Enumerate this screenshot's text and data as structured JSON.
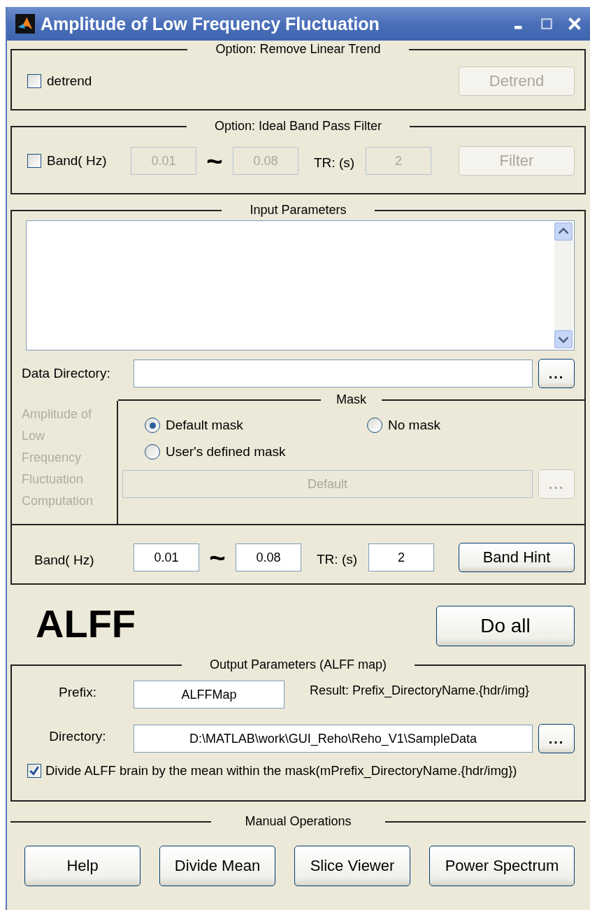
{
  "window": {
    "title": "Amplitude of Low Frequency Fluctuation"
  },
  "detrend_panel": {
    "title": "Option: Remove Linear Trend",
    "checkbox": {
      "label": "detrend",
      "checked": false
    },
    "button": {
      "label": "Detrend",
      "disabled": true
    }
  },
  "filter_panel": {
    "title": "Option: Ideal Band Pass Filter",
    "checkbox": {
      "label": "Band( Hz)",
      "checked": false
    },
    "fields_disabled": true,
    "low": "0.01",
    "tilde": "~",
    "high": "0.08",
    "tr_label": "TR: (s)",
    "tr": "2",
    "button": {
      "label": "Filter",
      "disabled": true
    }
  },
  "input_panel": {
    "title": "Input Parameters",
    "data_directory_label": "Data Directory:",
    "browse_button": {
      "label": "...",
      "disabled": false
    },
    "side_text": "Amplitude of Low Frequency Fluctuation Computation",
    "mask": {
      "title": "Mask",
      "options": [
        {
          "label": "Default mask",
          "selected": true
        },
        {
          "label": "No mask",
          "selected": false
        },
        {
          "label": "User's defined mask",
          "selected": false
        }
      ],
      "mask_field": {
        "value": "Default",
        "disabled": true
      },
      "browse_button": {
        "label": "...",
        "disabled": true
      }
    },
    "band_label": "Band( Hz)",
    "low": "0.01",
    "tilde": "~",
    "high": "0.08",
    "tr_label": "TR: (s)",
    "tr": "2",
    "hint_button": "Band Hint"
  },
  "heading": "ALFF",
  "do_all_button": "Do all",
  "output_panel": {
    "title": "Output Parameters (ALFF map)",
    "prefix_label": "Prefix:",
    "prefix": "ALFFMap",
    "result_note": "Result: Prefix_DirectoryName.{hdr/img}",
    "directory_label": "Directory:",
    "directory": "D:\\MATLAB\\work\\GUI_Reho\\Reho_V1\\SampleData",
    "browse_button": "...",
    "divide_checkbox": {
      "label": "Divide ALFF brain by the mean within the mask(mPrefix_DirectoryName.{hdr/img})",
      "checked": true
    }
  },
  "manual": {
    "title": "Manual Operations",
    "buttons": [
      "Help",
      "Divide Mean",
      "Slice Viewer",
      "Power Spectrum"
    ]
  }
}
